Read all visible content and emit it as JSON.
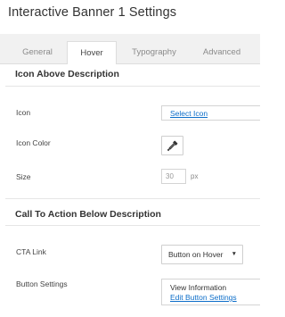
{
  "window": {
    "title": "Interactive Banner 1 Settings"
  },
  "tabs": [
    {
      "label": "General",
      "active": false
    },
    {
      "label": "Hover",
      "active": true
    },
    {
      "label": "Typography",
      "active": false
    },
    {
      "label": "Advanced",
      "active": false
    }
  ],
  "section_icon": {
    "title": "Icon Above Description",
    "icon_label": "Icon",
    "icon_link": "Select Icon",
    "color_label": "Icon Color",
    "size_label": "Size",
    "size_value": "30",
    "size_unit": "px"
  },
  "section_cta": {
    "title": "Call To Action Below Description",
    "link_label": "CTA Link",
    "link_value": "Button on Hover",
    "button_label": "Button Settings",
    "button_summary": "View Information",
    "button_edit": "Edit Button Settings"
  },
  "icons": {
    "color_picker": "eyedropper-icon",
    "dropdown": "caret-down-icon"
  }
}
